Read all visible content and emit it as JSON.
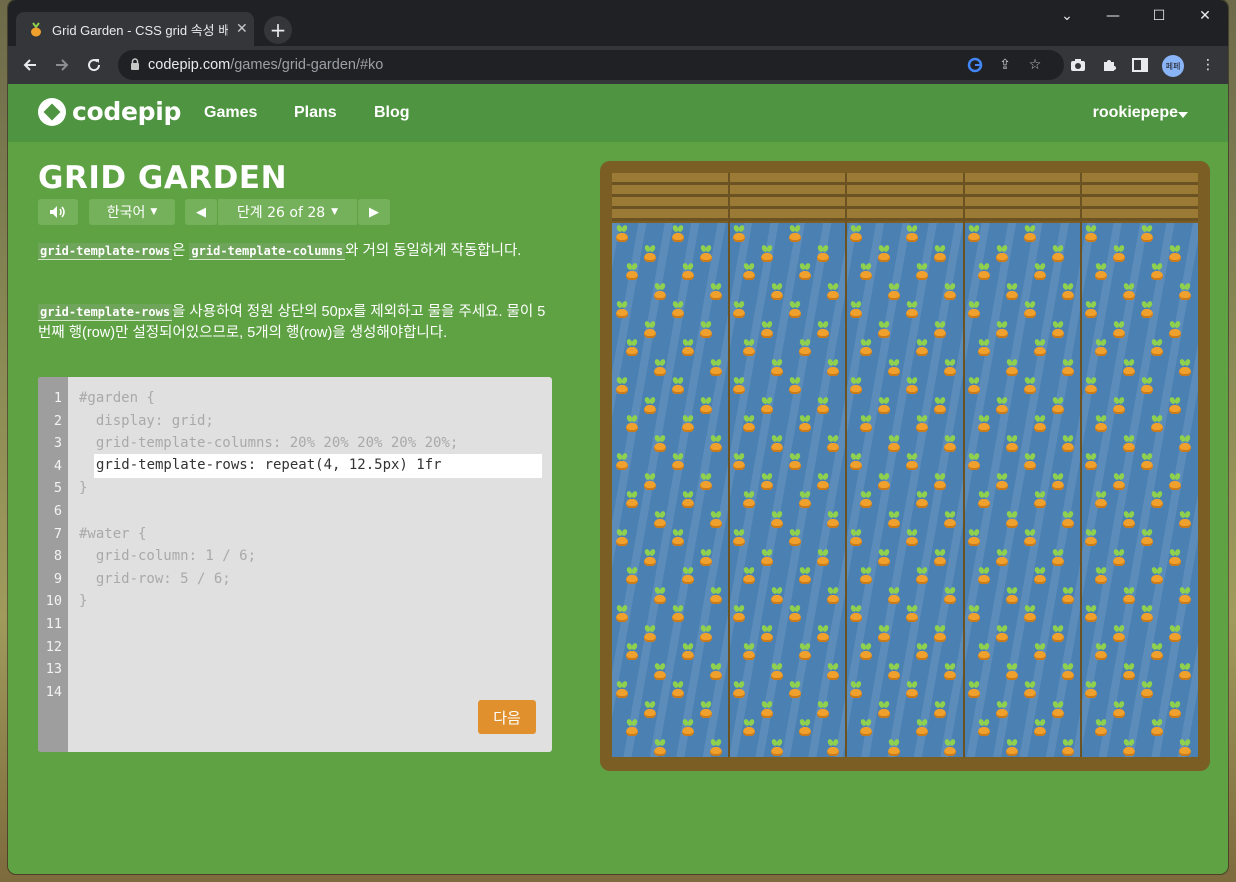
{
  "browser": {
    "tab_title": "Grid Garden - CSS grid 속성 배우기",
    "new_tab": "+",
    "url_host": "codepip.com",
    "url_path": "/games/grid-garden/#ko",
    "profile_initials": "페페",
    "window_controls": {
      "minimize": "—",
      "maximize": "☐",
      "close": "✕",
      "menu": "⌄"
    }
  },
  "site": {
    "logo": "codepip",
    "nav": [
      "Games",
      "Plans",
      "Blog"
    ],
    "user": "rookiepepe"
  },
  "game": {
    "title": "GRID GARDEN",
    "sound_icon": "speaker-icon",
    "language": "한국어",
    "level_label": "단계 26 of 28",
    "prev_icon": "◀",
    "next_icon": "▶",
    "desc1_code_a": "grid-template-rows",
    "desc1_text_a": "은 ",
    "desc1_code_b": "grid-template-columns",
    "desc1_text_b": "와 거의 동일하게 작동합니다.",
    "desc2_code": "grid-template-rows",
    "desc2_text": "을 사용하여 정원 상단의 50px를 제외하고 물을 주세요. 물이 5번째 행(row)만 설정되어있으므로, 5개의 행(row)을 생성해야합니다.",
    "next_button": "다음"
  },
  "editor": {
    "line_numbers": [
      "1",
      "2",
      "3",
      "4",
      "5",
      "6",
      "7",
      "8",
      "9",
      "10",
      "11",
      "12",
      "13",
      "14"
    ],
    "lines": [
      "#garden {",
      "  display: grid;",
      "  grid-template-columns: 20% 20% 20% 20% 20%;",
      "",
      "}",
      "",
      "#water {",
      "  grid-column: 1 / 6;",
      "  grid-row: 5 / 6;",
      "}"
    ],
    "input_value": "grid-template-rows: repeat(4, 12.5px) 1fr"
  },
  "colors": {
    "page_green": "#5ea244",
    "header_green": "#4f9440",
    "button_orange": "#e0912d",
    "water_blue": "#4a80b2",
    "soil_brown": "#7a5e24"
  }
}
